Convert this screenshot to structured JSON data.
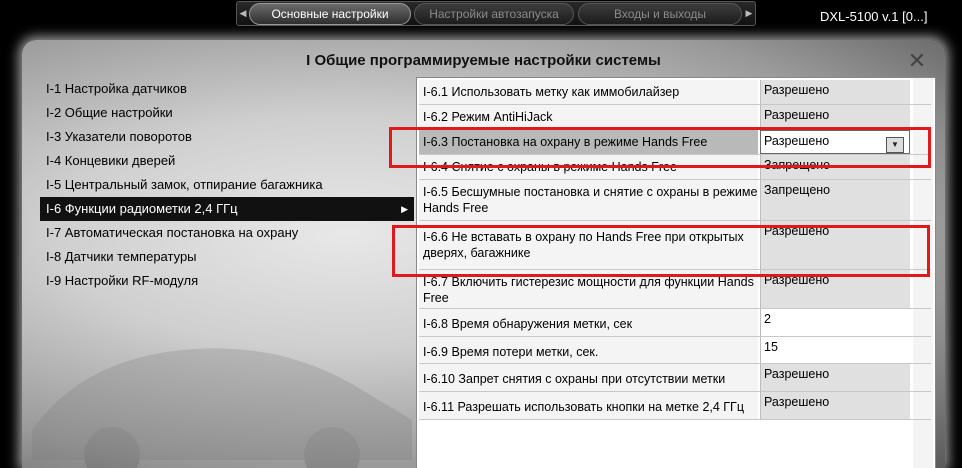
{
  "tabs": [
    {
      "label": "Основные настройки",
      "active": true
    },
    {
      "label": "Настройки автозапуска",
      "active": false
    },
    {
      "label": "Входы и выходы",
      "active": false
    }
  ],
  "device_label": "DXL-5100 v.1 [0...]",
  "panel": {
    "title": "I Общие программируемые настройки системы"
  },
  "menu": [
    {
      "label": "I-1 Настройка датчиков"
    },
    {
      "label": "I-2 Общие настройки"
    },
    {
      "label": "I-3 Указатели поворотов"
    },
    {
      "label": "I-4 Концевики дверей"
    },
    {
      "label": "I-5 Центральный замок, отпирание багажника"
    },
    {
      "label": "I-6 Функции радиометки 2,4 ГГц",
      "selected": true
    },
    {
      "label": "I-7 Автоматическая постановка на охрану"
    },
    {
      "label": "I-8 Датчики температуры"
    },
    {
      "label": "I-9 Настройки RF-модуля"
    }
  ],
  "settings": [
    {
      "name": "I-6.1 Использовать метку как иммобилайзер",
      "value": "Разрешено"
    },
    {
      "name": "I-6.2 Режим AntiHiJack",
      "value": "Разрешено"
    },
    {
      "name": "I-6.3 Постановка на охрану в режиме Hands Free",
      "value": "Разрешено",
      "highlighted": true
    },
    {
      "name": "I-6.4 Снятие с охраны в режиме Hands Free",
      "value": "Запрещено"
    },
    {
      "name": "I-6.5 Бесшумные постановка и снятие с охраны в режиме Hands Free",
      "value": "Запрещено"
    },
    {
      "name": "I-6.6 Не вставать в охрану по Hands Free при открытых дверях, багажнике",
      "value": "Разрешено"
    },
    {
      "name": "I-6.7 Включить гистерезис мощности для функции Hands Free",
      "value": "Разрешено"
    },
    {
      "name": "I-6.8 Время обнаружения метки, сек",
      "value": "2"
    },
    {
      "name": "I-6.9 Время потери метки, сек.",
      "value": "15"
    },
    {
      "name": "I-6.10 Запрет снятия с охраны при отсутствии метки",
      "value": "Разрешено"
    },
    {
      "name": "I-6.11 Разрешать использовать кнопки на метке 2,4 ГГц",
      "value": "Разрешено"
    }
  ],
  "colors": {
    "annotation_red": "#e01a1a",
    "selected_menu_bg": "#111111"
  }
}
